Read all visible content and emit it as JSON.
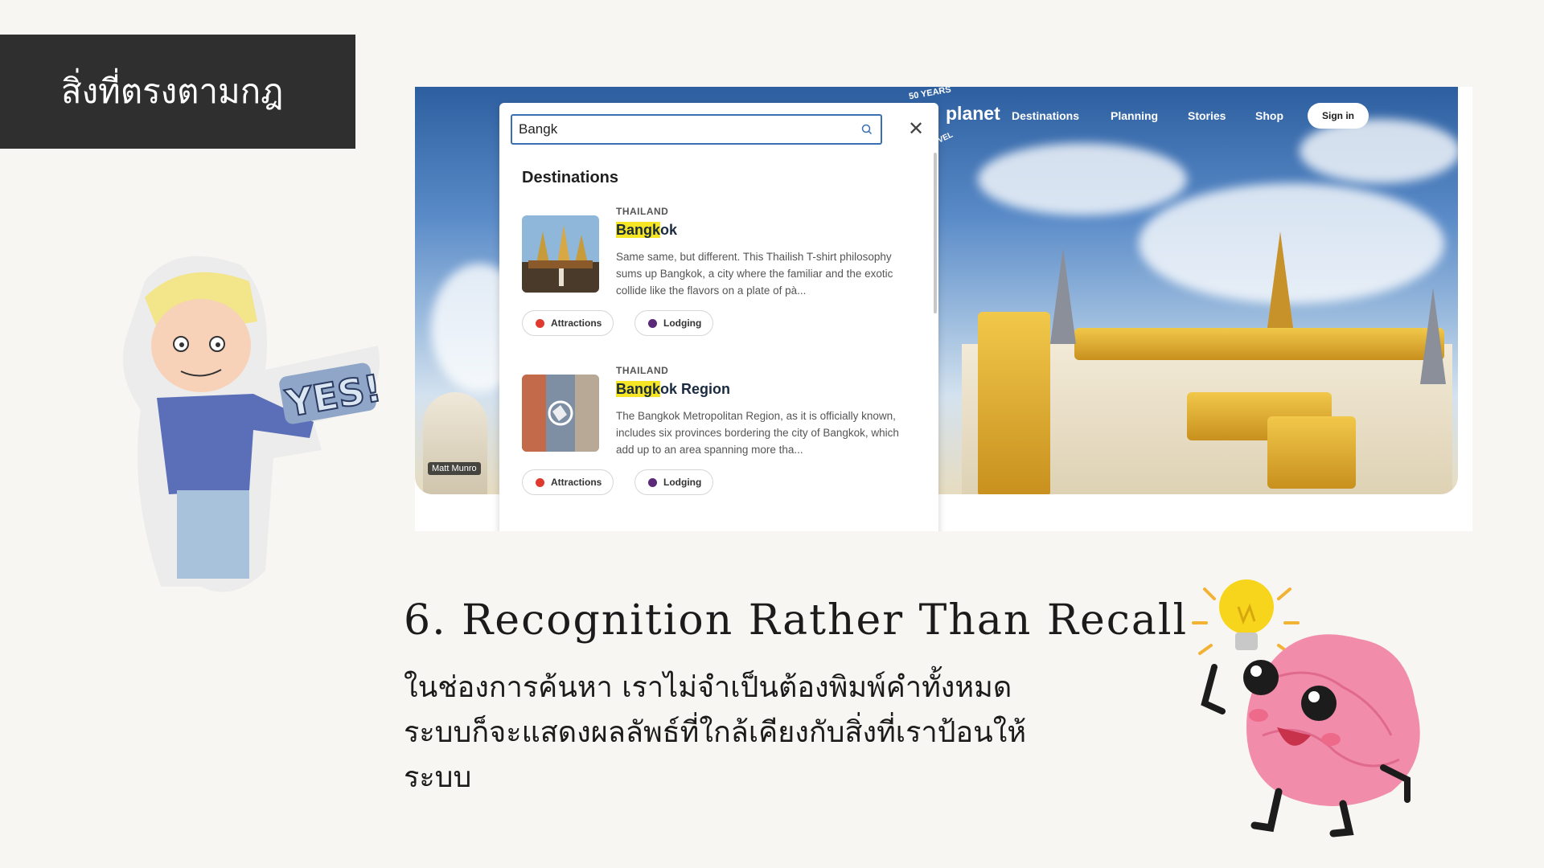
{
  "slide": {
    "title": "สิ่งที่ตรงตามกฎ",
    "heading": "6. Recognition Rather Than Recall",
    "body_lines": [
      "ในช่องการค้นหา เราไม่จำเป็นต้องพิมพ์คำทั้งหมด",
      "ระบบก็จะแสดงผลลัพธ์ที่ใกล้เคียงกับสิ่งที่เราป้อนให้",
      "ระบบ"
    ],
    "yes_sticker_text": "YES!"
  },
  "screenshot": {
    "logo": {
      "text": "planet",
      "years": "50 YEARS",
      "sub": "VEL"
    },
    "nav": [
      "Destinations",
      "Planning",
      "Stories",
      "Shop"
    ],
    "signin_label": "Sign in",
    "photo_credit": "Matt Munro",
    "search": {
      "value": "Bangk",
      "icon": "search-icon"
    },
    "close_icon": "close-icon",
    "section_title": "Destinations",
    "results": [
      {
        "country": "THAILAND",
        "name_match": "Bangk",
        "name_rest": "ok",
        "description": "Same same, but different. This Thailish T-shirt philosophy sums up Bangkok, a city where the familiar and the exotic collide like the flavors on a plate of pà...",
        "chips": [
          "Attractions",
          "Lodging"
        ]
      },
      {
        "country": "THAILAND",
        "name_match": "Bangk",
        "name_rest": "ok Region",
        "description": "The Bangkok Metropolitan Region, as it is officially known, includes six provinces bordering the city of Bangkok, which add up to an area spanning more tha...",
        "chips": [
          "Attractions",
          "Lodging"
        ]
      }
    ],
    "colors": {
      "accent_blue": "#3b6fb3",
      "highlight": "#f5e524",
      "attractions_dot": "#e03a2f",
      "lodging_dot": "#5a2a78"
    }
  }
}
